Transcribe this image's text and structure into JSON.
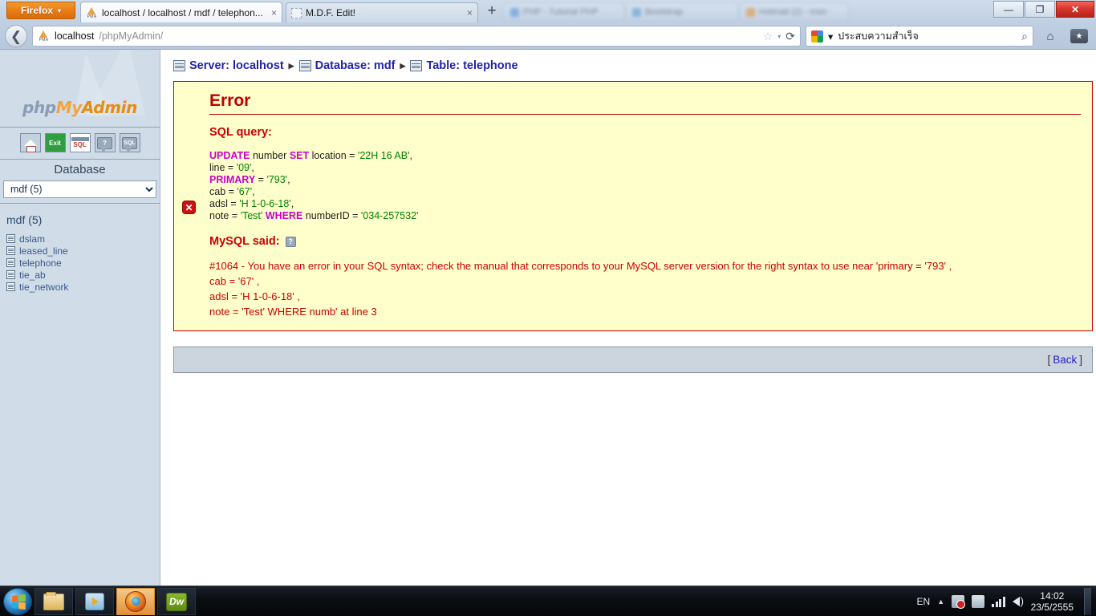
{
  "window": {
    "minimize_label": "—",
    "maximize_label": "❐",
    "close_label": "✕"
  },
  "browser": {
    "app_button_label": "Firefox",
    "app_button_caret": "▾",
    "tabs": [
      {
        "title": "localhost / localhost / mdf / telephon...",
        "close_label": "×",
        "active": true
      },
      {
        "title": "M.D.F. Edit!",
        "close_label": "×",
        "active": false
      }
    ],
    "ghost_tabs": [
      {
        "title": "PHP - Tutorial PHP"
      },
      {
        "title": "Bootstrap"
      },
      {
        "title": "Hotmail (2) - msn"
      }
    ],
    "new_tab_label": "+",
    "back_label": "❮",
    "url_host": "localhost",
    "url_path": "/phpMyAdmin/",
    "star_label": "☆",
    "dropdown_label": "▾",
    "reload_label": "⟳",
    "search_value": "ประสบความสำเร็จ",
    "search_dropdown_label": "▾",
    "magnify_label": "⌕",
    "home_label": "⌂",
    "bookmark_label": "★",
    "bookmark_caret": "▾"
  },
  "sidebar": {
    "logo": {
      "php": "php",
      "my": "My",
      "admin": "Admin"
    },
    "nav_icons": [
      {
        "name": "home-icon",
        "label": ""
      },
      {
        "name": "exit-icon",
        "label": "Exit"
      },
      {
        "name": "sql-window-icon",
        "label": "SQL"
      },
      {
        "name": "documentation-icon",
        "label": "?"
      },
      {
        "name": "sql-help-icon",
        "label": "SQL"
      }
    ],
    "database_label": "Database",
    "database_selected": "mdf (5)",
    "database_options": [
      "mdf (5)"
    ],
    "db_heading": "mdf (5)",
    "tables": [
      {
        "name": "dslam"
      },
      {
        "name": "leased_line"
      },
      {
        "name": "telephone"
      },
      {
        "name": "tie_ab"
      },
      {
        "name": "tie_network"
      }
    ]
  },
  "breadcrumb": [
    {
      "label": "Server: localhost",
      "icon": "server-icon"
    },
    {
      "label": "Database: mdf",
      "icon": "database-icon"
    },
    {
      "label": "Table: telephone",
      "icon": "table-icon"
    }
  ],
  "breadcrumb_separator": "▶",
  "error_panel": {
    "title": "Error",
    "sql_query_heading": "SQL query:",
    "error_marker": "✕",
    "sql_lines": [
      [
        {
          "t": "UPDATE",
          "c": "kw"
        },
        {
          "t": " number ",
          "c": "idf"
        },
        {
          "t": "SET",
          "c": "kw"
        },
        {
          "t": " location = ",
          "c": "idf"
        },
        {
          "t": "'22H 16 AB'",
          "c": "str"
        },
        {
          "t": ",",
          "c": "idf"
        }
      ],
      [
        {
          "t": "line = ",
          "c": "idf"
        },
        {
          "t": "'09'",
          "c": "str"
        },
        {
          "t": ",",
          "c": "idf"
        }
      ],
      [
        {
          "t": "PRIMARY",
          "c": "kw"
        },
        {
          "t": " = ",
          "c": "idf"
        },
        {
          "t": "'793'",
          "c": "str"
        },
        {
          "t": ",",
          "c": "idf"
        }
      ],
      [
        {
          "t": "cab = ",
          "c": "idf"
        },
        {
          "t": "'67'",
          "c": "str"
        },
        {
          "t": ",",
          "c": "idf"
        }
      ],
      [
        {
          "t": "adsl = ",
          "c": "idf"
        },
        {
          "t": "'H 1-0-6-18'",
          "c": "str"
        },
        {
          "t": ",",
          "c": "idf"
        }
      ],
      [
        {
          "t": "note = ",
          "c": "idf"
        },
        {
          "t": "'Test'",
          "c": "str"
        },
        {
          "t": " ",
          "c": "idf"
        },
        {
          "t": "WHERE",
          "c": "kw"
        },
        {
          "t": " numberID = ",
          "c": "idf"
        },
        {
          "t": "'034-257532'",
          "c": "str"
        }
      ]
    ],
    "mysql_said_heading": "MySQL said:",
    "help_icon_label": "?",
    "mysql_message_lines": [
      "#1064 - You have an error in your SQL syntax; check the manual that corresponds to your MySQL server version for the right syntax to use near 'primary = '793' ,",
      "cab = '67' ,",
      "adsl = 'H 1-0-6-18' ,",
      "note = 'Test' WHERE numb' at line 3"
    ]
  },
  "footer": {
    "back_open_bracket": "[",
    "back_label": "Back",
    "back_close_bracket": "]"
  },
  "taskbar": {
    "start_label": "",
    "items": [
      {
        "name": "explorer",
        "label": ""
      },
      {
        "name": "media-player",
        "label": ""
      },
      {
        "name": "firefox",
        "label": "",
        "active": true
      },
      {
        "name": "dreamweaver",
        "label": "Dw"
      }
    ],
    "tray": {
      "language": "EN",
      "show_hidden_label": "▲",
      "time": "14:02",
      "date": "23/5/2555"
    }
  },
  "colors": {
    "error_border": "#cc0000",
    "error_bg": "#ffffcc",
    "keyword": "#cc00cc",
    "string": "#008000",
    "link": "#2222aa",
    "accent_orange": "#e88c10"
  }
}
